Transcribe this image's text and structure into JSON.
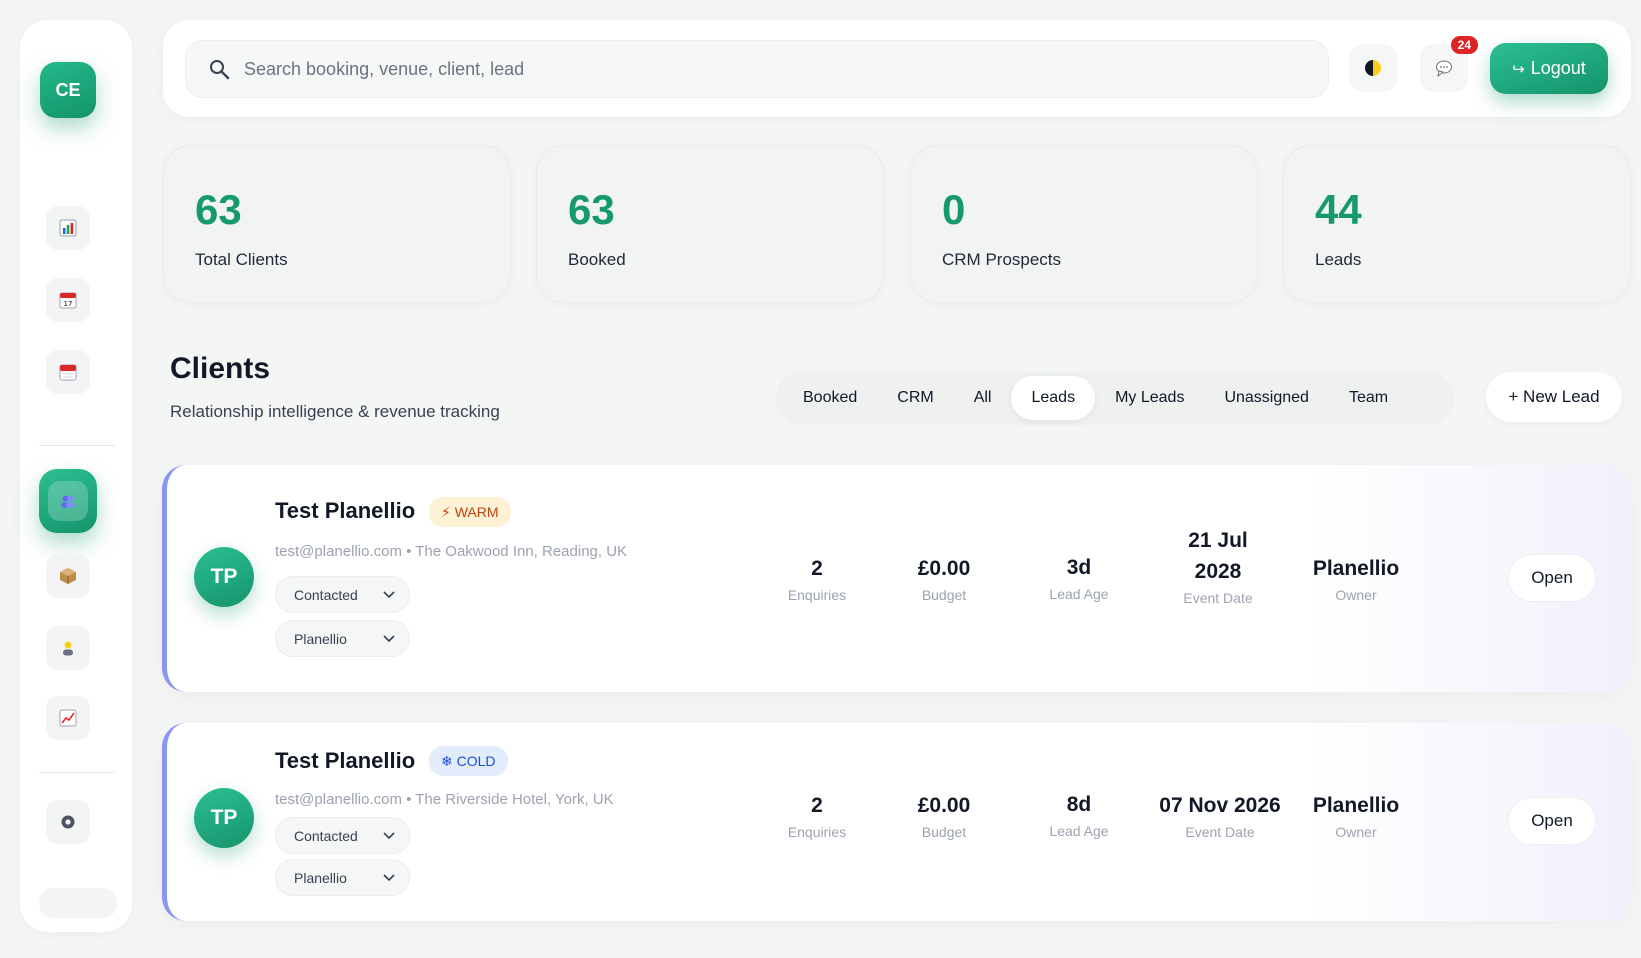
{
  "sidebar": {
    "avatar": "CE",
    "items": [
      {
        "icon": "bar-chart-icon",
        "color": "#2563eb"
      },
      {
        "icon": "calendar-17-icon",
        "color": "#dc2626"
      },
      {
        "icon": "calendar-tear-icon",
        "color": "#dc2626"
      },
      {
        "icon": "users-icon",
        "color": "#6366f1",
        "active": true
      },
      {
        "icon": "package-icon",
        "color": "#a16207"
      },
      {
        "icon": "person-icon",
        "color": "#ca8a04"
      },
      {
        "icon": "trend-chart-icon",
        "color": "#dc2626"
      },
      {
        "icon": "gear-icon",
        "color": "#4b5563"
      }
    ]
  },
  "header": {
    "search_placeholder": "Search booking, venue, client, lead",
    "notification_count": "24",
    "logout_label": "Logout"
  },
  "stats": [
    {
      "value": "63",
      "label": "Total Clients"
    },
    {
      "value": "63",
      "label": "Booked"
    },
    {
      "value": "0",
      "label": "CRM Prospects"
    },
    {
      "value": "44",
      "label": "Leads"
    }
  ],
  "clients": {
    "title": "Clients",
    "subtitle": "Relationship intelligence & revenue tracking",
    "tabs": [
      "Booked",
      "CRM",
      "All",
      "Leads",
      "My Leads",
      "Unassigned",
      "Team"
    ],
    "active_tab": "Leads",
    "new_lead_label": "+ New Lead"
  },
  "rows": [
    {
      "initials": "TP",
      "name": "Test Planellio",
      "tag": "⚡ WARM",
      "meta": "test@planellio.com • The Oakwood Inn, Reading, UK",
      "status": "Contacted",
      "owner_select": "Planellio",
      "enquiries": "2",
      "enquiries_label": "Enquiries",
      "budget": "£0.00",
      "budget_label": "Budget",
      "lead_age": "3d",
      "lead_age_label": "Lead Age",
      "event_date": "21 Jul 2028",
      "event_date_label": "Event Date",
      "owner": "Planellio",
      "owner_label": "Owner",
      "open_label": "Open"
    },
    {
      "initials": "TP",
      "name": "Test Planellio",
      "tag": "❄ COLD",
      "meta": "test@planellio.com • The Riverside Hotel, York, UK",
      "status": "Contacted",
      "owner_select": "Planellio",
      "enquiries": "2",
      "enquiries_label": "Enquiries",
      "budget": "£0.00",
      "budget_label": "Budget",
      "lead_age": "8d",
      "lead_age_label": "Lead Age",
      "event_date": "07 Nov 2026",
      "event_date_label": "Event Date",
      "owner": "Planellio",
      "owner_label": "Owner",
      "open_label": "Open"
    }
  ]
}
